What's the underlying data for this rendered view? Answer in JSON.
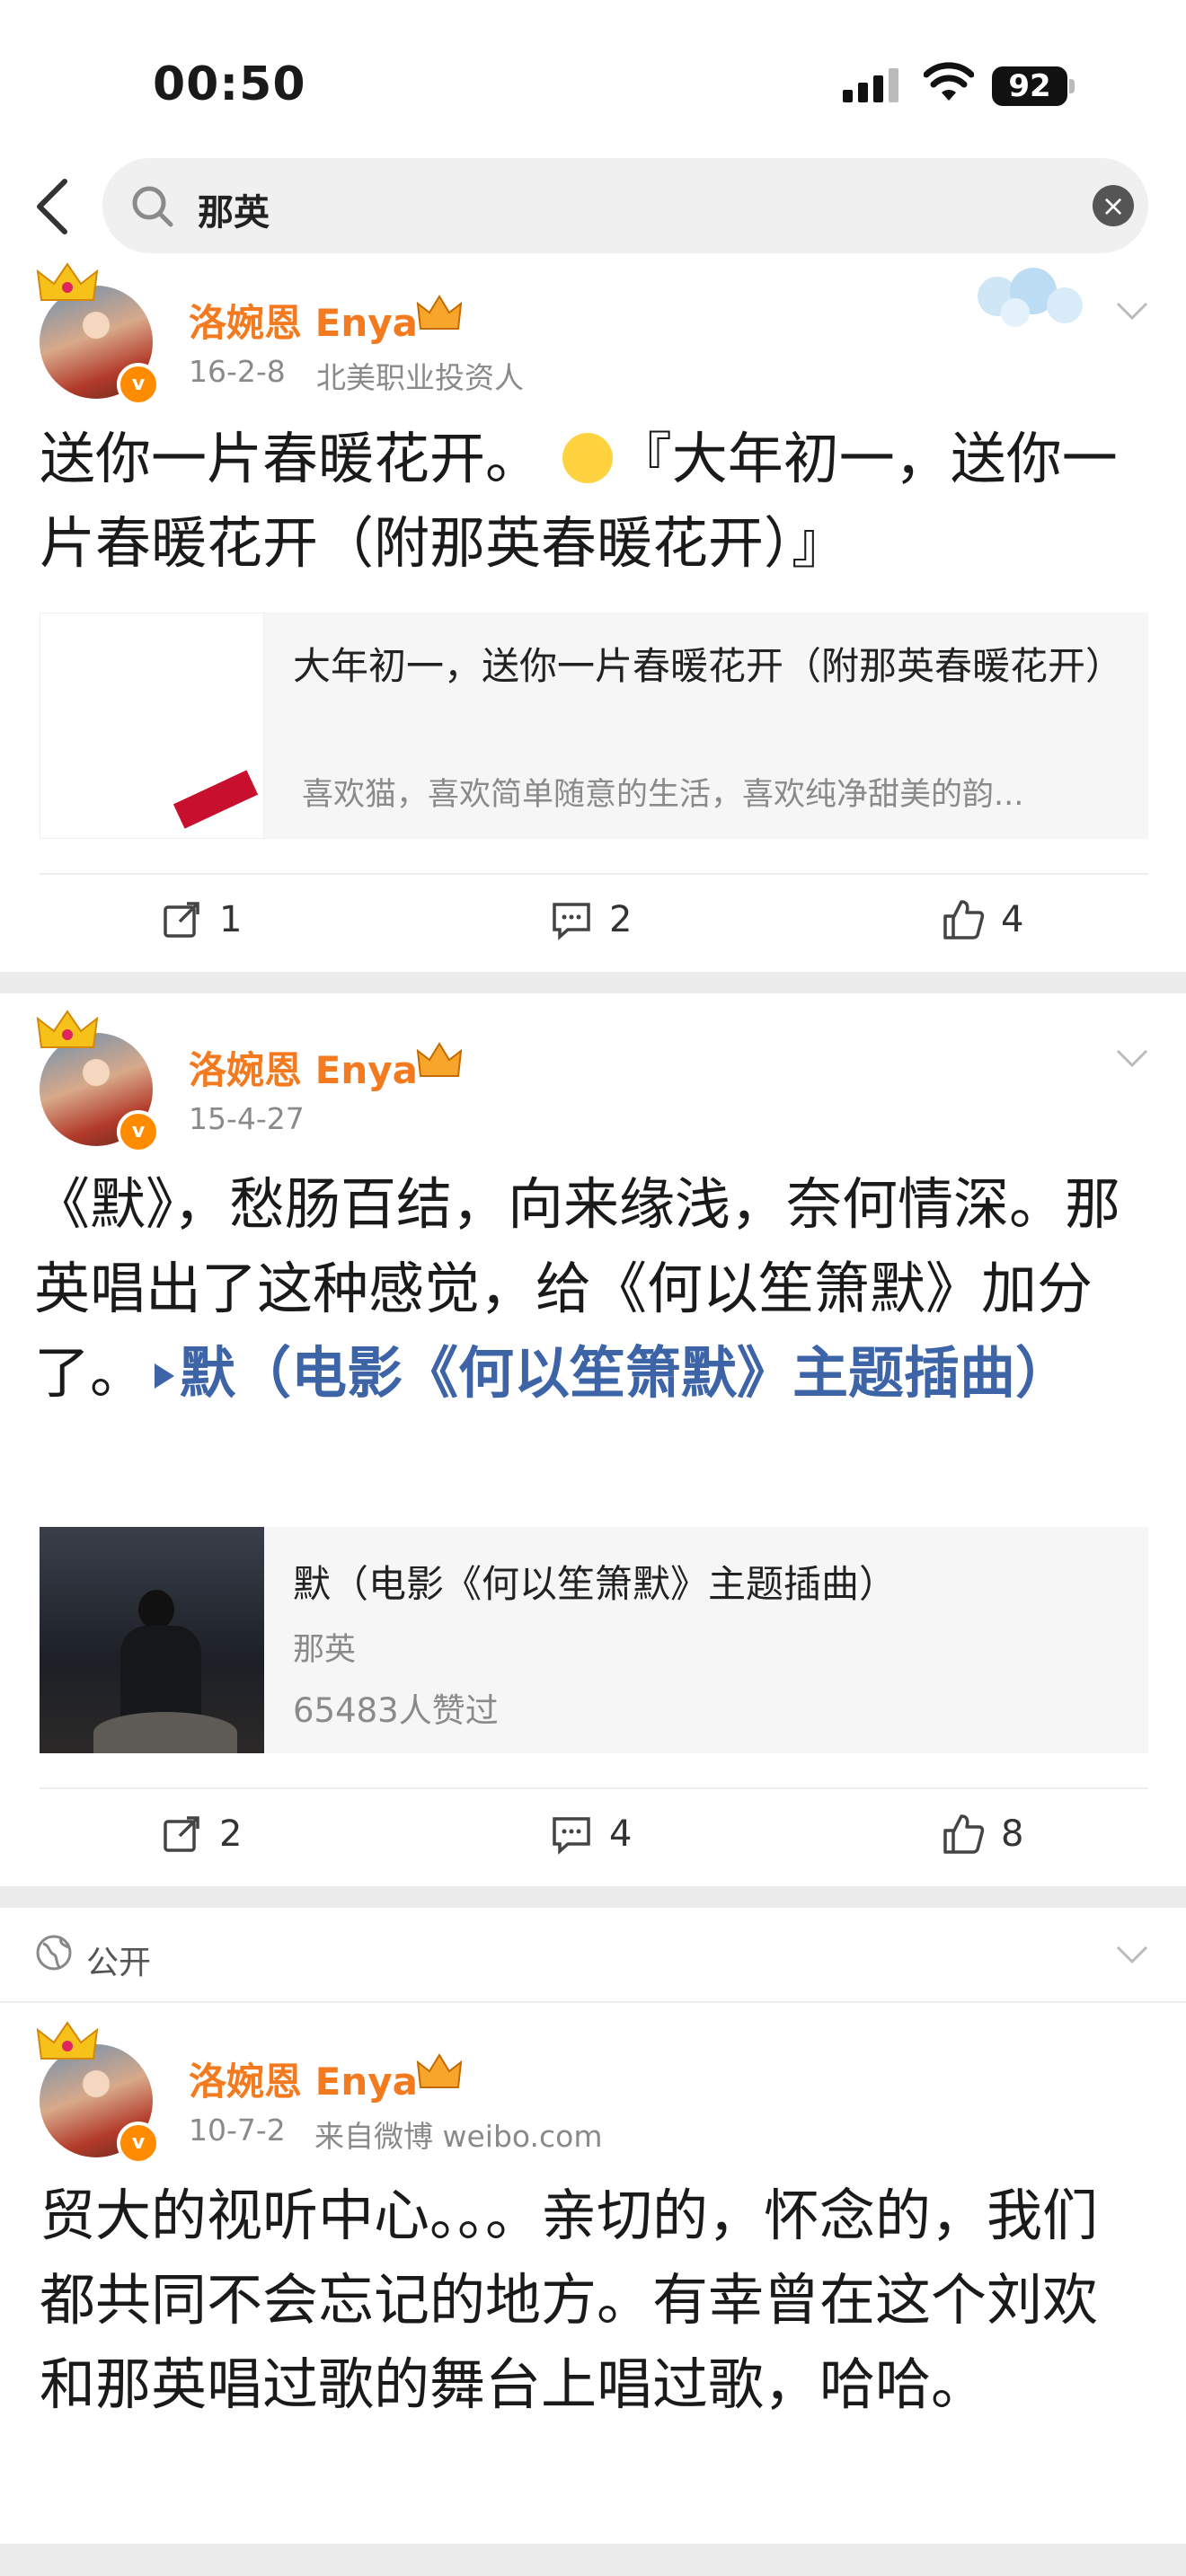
{
  "status_bar": {
    "time": "00:50",
    "battery": "92"
  },
  "search": {
    "query": "那英"
  },
  "posts": [
    {
      "user": "洛婉恩 Enya",
      "date": "16-2-8",
      "source": "北美职业投资人",
      "text_before": "送你一片春暖花开。",
      "text_after": "『大年初一，送你一片春暖花开（附那英春暖花开）』",
      "card": {
        "title": "大年初一，送你一片春暖花开（附那英春暖花开）",
        "subtitle": "喜欢猫，喜欢简单随意的生活，喜欢纯净甜美的韵..."
      },
      "actions": {
        "reposts": "1",
        "comments": "2",
        "likes": "4"
      }
    },
    {
      "user": "洛婉恩 Enya",
      "date": "15-4-27",
      "text": "《默》，愁肠百结，向来缘浅，奈何情深。那英唱出了这种感觉，给《何以笙箫默》加分了。",
      "link": "默（电影《何以笙箫默》主题插曲）",
      "card": {
        "title": "默（电影《何以笙箫默》主题插曲）",
        "artist": "那英",
        "likes": "65483人赞过"
      },
      "actions": {
        "reposts": "2",
        "comments": "4",
        "likes": "8"
      }
    },
    {
      "visibility": "公开",
      "user": "洛婉恩 Enya",
      "date": "10-7-2",
      "source": "来自微博 weibo.com",
      "text": "贸大的视听中心。。。亲切的，怀念的，我们都共同不会忘记的地方。有幸曾在这个刘欢和那英唱过歌的舞台上唱过歌，哈哈。"
    }
  ],
  "colors": {
    "username": "#f47a20",
    "link": "#3e64a8",
    "meta": "#8a8a8a",
    "divider": "#ececec"
  }
}
